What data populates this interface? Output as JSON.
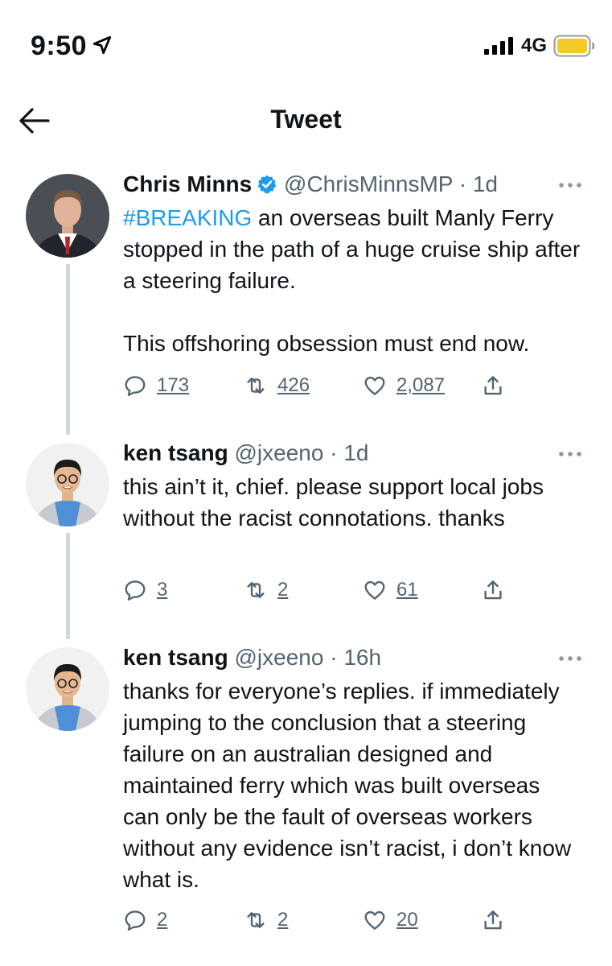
{
  "status_bar": {
    "time": "9:50",
    "network": "4G"
  },
  "header": {
    "title": "Tweet"
  },
  "tweets": [
    {
      "name": "Chris Minns",
      "handle": "@ChrisMinnsMP",
      "separator": "·",
      "time": "1d",
      "verified": true,
      "hashtag": "#BREAKING",
      "text_after_hashtag": " an overseas built Manly Ferry stopped in the path of a huge cruise ship after a steering failure.",
      "text_paragraph_2": "This offshoring obsession must end now.",
      "replies": "173",
      "retweets": "426",
      "likes": "2,087"
    },
    {
      "name": "ken tsang",
      "handle": "@jxeeno",
      "separator": "·",
      "time": "1d",
      "text": "this ain’t it, chief. please support local jobs without the racist connotations. thanks",
      "replies": "3",
      "retweets": "2",
      "likes": "61"
    },
    {
      "name": "ken tsang",
      "handle": "@jxeeno",
      "separator": "·",
      "time": "16h",
      "text": "thanks for everyone’s replies. if immediately jumping to the conclusion that a steering failure on an australian designed and maintained ferry which was built overseas can only be the fault of overseas workers without any evidence isn’t racist, i don’t know what is.",
      "replies": "2",
      "retweets": "2",
      "likes": "20"
    }
  ],
  "icons": {
    "location": "location-arrow-icon",
    "signal": "signal-bars-icon",
    "battery": "battery-icon",
    "back": "back-arrow-icon",
    "verified": "verified-badge-icon",
    "more": "more-dots-icon",
    "reply": "reply-icon",
    "retweet": "retweet-icon",
    "like": "heart-icon",
    "share": "share-icon"
  },
  "colors": {
    "accent": "#1d9bf0",
    "text_primary": "#0f1419",
    "text_secondary": "#536471",
    "thread_line": "#cfd9de",
    "battery_fill": "#f4c92a"
  }
}
